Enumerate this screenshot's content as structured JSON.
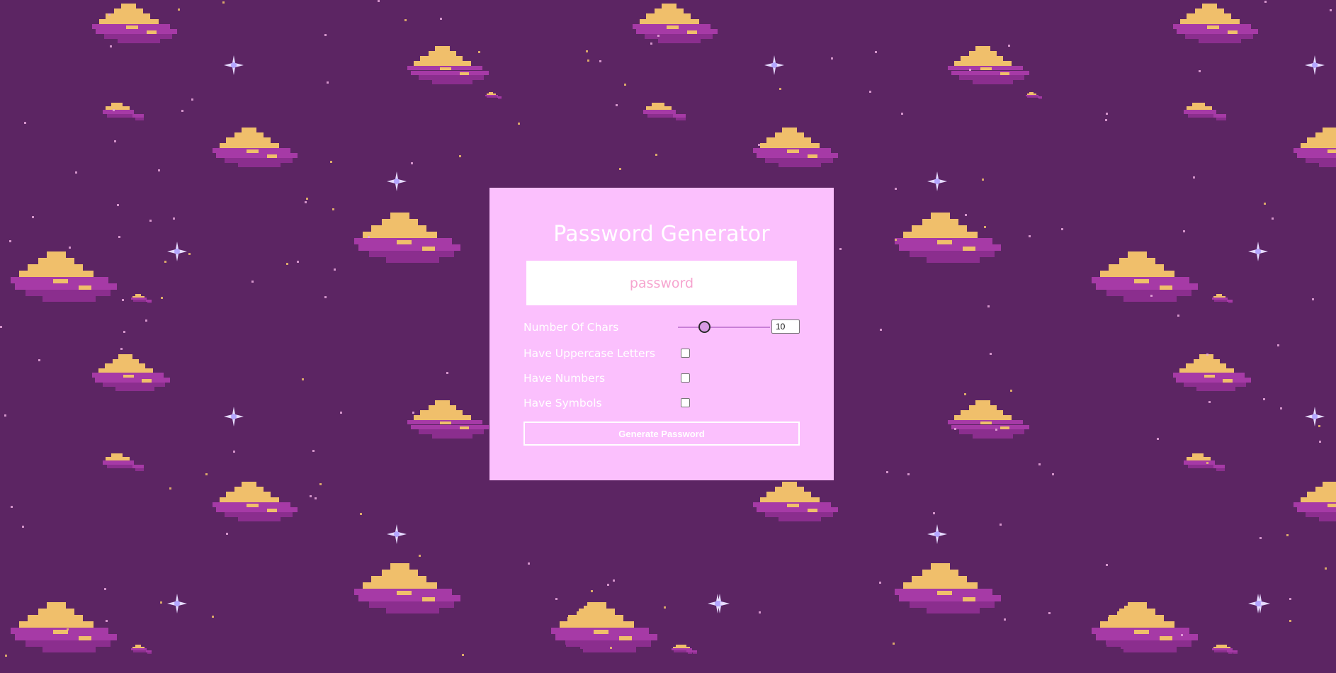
{
  "app": {
    "title": "Password Generator"
  },
  "password": {
    "value": "password"
  },
  "options": {
    "length_label": "Number Of Chars",
    "length_value": "10",
    "length_fraction": 0.23,
    "uppercase_label": "Have Uppercase Letters",
    "uppercase_checked": false,
    "numbers_label": "Have Numbers",
    "numbers_checked": false,
    "symbols_label": "Have Symbols",
    "symbols_checked": false
  },
  "actions": {
    "generate_label": "Generate Password"
  },
  "colors": {
    "background": "#5c2563",
    "card": "#fbc0fd",
    "cloud_gold": "#f0bf6b",
    "cloud_magenta": "#a63aa6",
    "password_text": "#f6a4cf"
  }
}
